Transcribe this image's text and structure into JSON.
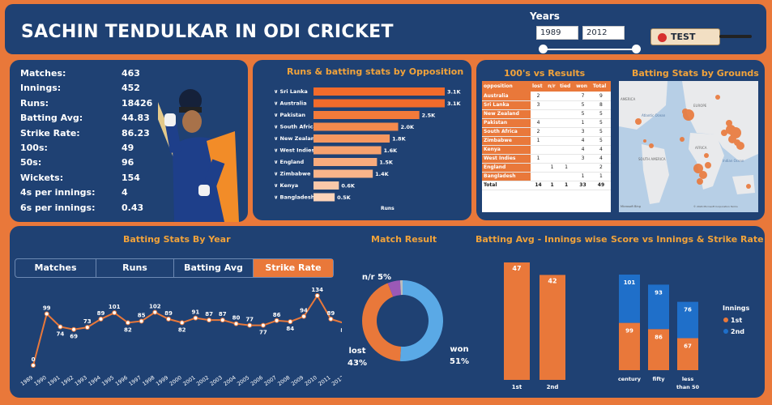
{
  "header": {
    "title": "SACHIN TENDULKAR IN ODI CRICKET",
    "years_label": "Years",
    "year_from": "1989",
    "year_to": "2012",
    "format_button": "TEST"
  },
  "stats": [
    {
      "label": "Matches:",
      "value": "463"
    },
    {
      "label": "Innings:",
      "value": "452"
    },
    {
      "label": "Runs:",
      "value": "18426"
    },
    {
      "label": "Batting Avg:",
      "value": "44.83"
    },
    {
      "label": "Strike Rate:",
      "value": "86.23"
    },
    {
      "label": "100s:",
      "value": "49"
    },
    {
      "label": "50s:",
      "value": "96"
    },
    {
      "label": "Wickets:",
      "value": "154"
    },
    {
      "label": "4s per innings:",
      "value": "4"
    },
    {
      "label": "6s per innings:",
      "value": "0.43"
    }
  ],
  "hundreds_table": {
    "title": "100's vs Results",
    "columns": [
      "opposition",
      "lost",
      "n/r",
      "tied",
      "won",
      "Total"
    ],
    "rows": [
      [
        "Australia",
        "2",
        "",
        "",
        "7",
        "9"
      ],
      [
        "Sri Lanka",
        "3",
        "",
        "",
        "5",
        "8"
      ],
      [
        "New Zealand",
        "",
        "",
        "",
        "5",
        "5"
      ],
      [
        "Pakistan",
        "4",
        "",
        "",
        "1",
        "5"
      ],
      [
        "South Africa",
        "2",
        "",
        "",
        "3",
        "5"
      ],
      [
        "Zimbabwe",
        "1",
        "",
        "",
        "4",
        "5"
      ],
      [
        "Kenya",
        "",
        "",
        "",
        "4",
        "4"
      ],
      [
        "West Indies",
        "1",
        "",
        "",
        "3",
        "4"
      ],
      [
        "England",
        "",
        "1",
        "1",
        "",
        "2"
      ],
      [
        "Bangladesh",
        "",
        "",
        "",
        "1",
        "1"
      ]
    ],
    "total": [
      "Total",
      "14",
      "1",
      "1",
      "33",
      "49"
    ]
  },
  "map": {
    "title": "Batting Stats by Grounds",
    "labels": {
      "atlantic": "Atlantic Ocean",
      "south_america": "SOUTH AMERICA",
      "africa": "AFRICA",
      "indian_ocean": "Indian Ocean",
      "europe": "EUROPE",
      "america": "AMERICA",
      "microsoft": "Microsoft Bing",
      "copyright": "© 2024 Microsoft Corporation  Terms"
    }
  },
  "tabs": [
    "Matches",
    "Runs",
    "Batting Avg",
    "Strike Rate"
  ],
  "chart_data": [
    {
      "type": "bar",
      "title": "Runs & batting stats by Opposition",
      "xlabel": "Runs",
      "categories": [
        "Sri Lanka",
        "Australia",
        "Pakistan",
        "South Africa",
        "New Zealand",
        "West Indies",
        "England",
        "Zimbabwe",
        "Kenya",
        "Bangladesh"
      ],
      "values": [
        3100,
        3100,
        2500,
        2000,
        1800,
        1600,
        1500,
        1400,
        600,
        500
      ],
      "data_labels": [
        "3.1K",
        "3.1K",
        "2.5K",
        "2.0K",
        "1.8K",
        "1.6K",
        "1.5K",
        "1.4K",
        "0.6K",
        "0.5K"
      ],
      "colors": [
        "#f26b2b",
        "#f26b2b",
        "#f37a3a",
        "#f58a4d",
        "#f69760",
        "#f7a26f",
        "#f8ab7d",
        "#f9b48a",
        "#fbc8a9",
        "#fcd4ba"
      ]
    },
    {
      "type": "line",
      "title": "Batting Stats By Year",
      "x": [
        "1989",
        "1990",
        "1991",
        "1992",
        "1993",
        "1994",
        "1995",
        "1996",
        "1997",
        "1998",
        "1999",
        "2000",
        "2001",
        "2002",
        "2003",
        "2004",
        "2005",
        "2006",
        "2007",
        "2008",
        "2009",
        "2010",
        "2011",
        "2012"
      ],
      "values": [
        0,
        99,
        74,
        69,
        73,
        89,
        101,
        82,
        85,
        102,
        89,
        82,
        91,
        87,
        87,
        80,
        77,
        77,
        86,
        84,
        94,
        134,
        89,
        81
      ],
      "color": "#e9783a"
    },
    {
      "type": "pie",
      "title": "Match Result",
      "labels": [
        "won",
        "lost",
        "n/r",
        "tied"
      ],
      "values": [
        51,
        43,
        5,
        1
      ],
      "label_text": [
        "won\n51%",
        "lost\n43%",
        "n/r 5%",
        ""
      ],
      "colors": [
        "#5aa9e6",
        "#e9783a",
        "#9b59b6",
        "#bdbdbd"
      ]
    },
    {
      "type": "bar",
      "title": "Batting Avg - Innings wise",
      "categories": [
        "1st",
        "2nd"
      ],
      "values": [
        47,
        42
      ],
      "color": "#e9783a"
    },
    {
      "type": "bar",
      "title": "Score vs Innings & Strike Rate",
      "categories": [
        "century",
        "fifty",
        "less than 50"
      ],
      "series": [
        {
          "name": "1st",
          "values": [
            99,
            86,
            67
          ],
          "color": "#e9783a"
        },
        {
          "name": "2nd",
          "values": [
            101,
            93,
            76
          ],
          "color": "#1f6fc9"
        }
      ],
      "legend_title": "Innings"
    }
  ]
}
